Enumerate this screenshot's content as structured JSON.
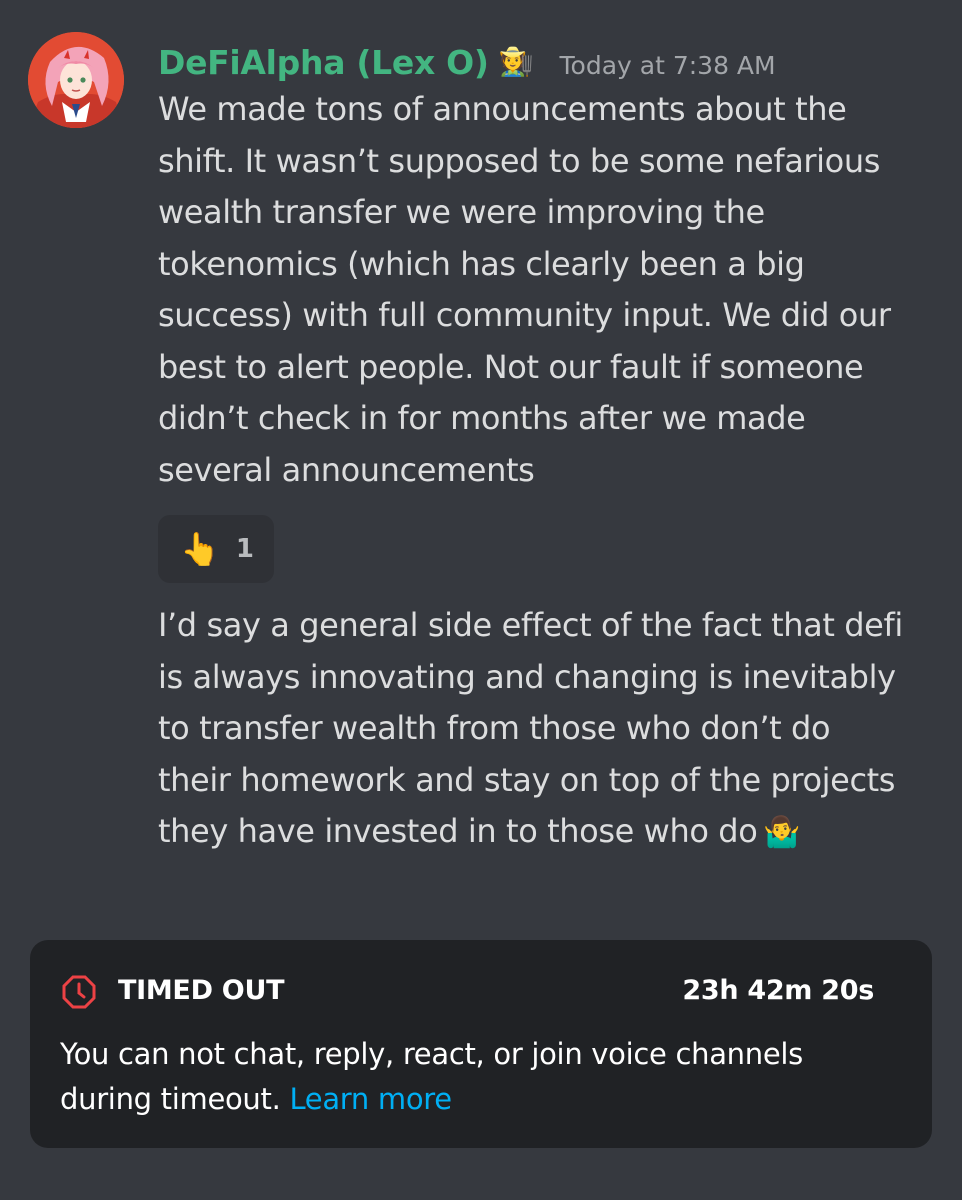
{
  "message": {
    "username": "DeFiAlpha (Lex O)",
    "role_emoji": "🧑‍🌾",
    "timestamp": "Today at 7:38 AM",
    "avatar_icon": "anime-avatar",
    "username_color": "#43b581",
    "text_1": "We made tons of announcements about the\nshift. It wasn’t supposed to be some nefarious\nwealth transfer we were improving the\ntokenomics (which has clearly been a big\nsuccess) with full community input. We did our\nbest to alert people. Not our fault if someone\ndidn’t check in for months after we made\nseveral announcements",
    "reaction": {
      "emoji": "👆",
      "count": "1"
    },
    "text_2": "I’d say a general side effect of the fact that defi\nis always innovating and changing is inevitably\nto transfer wealth from those who don’t do\ntheir homework and stay on top of the projects\nthey have invested in to those who do",
    "text_2_emoji": "🤷‍♂️"
  },
  "timeout": {
    "icon": "stop-octagon-icon",
    "icon_color": "#ed4245",
    "title": "TIMED OUT",
    "timer": "23h 42m 20s",
    "description": "You can not chat, reply, react, or join voice channels during timeout.",
    "link": "Learn more",
    "link_color": "#00aff4"
  }
}
